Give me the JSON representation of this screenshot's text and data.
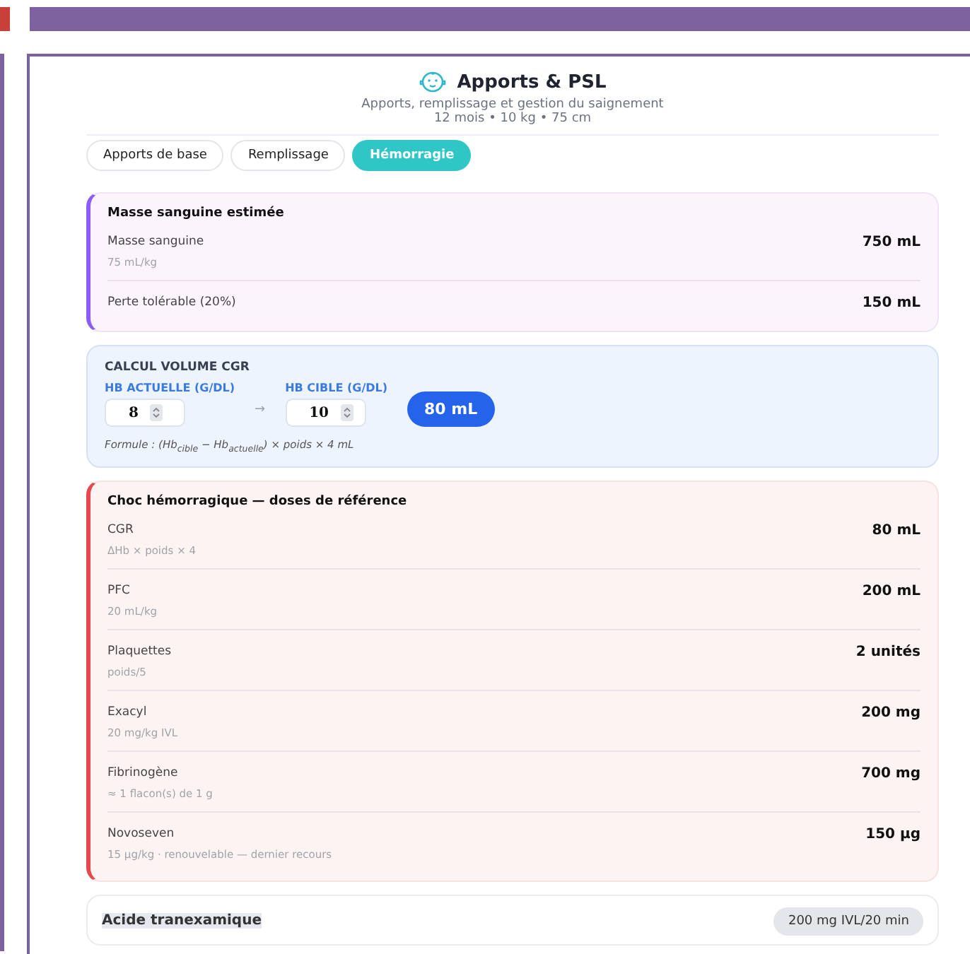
{
  "header": {
    "title": "Apports & PSL",
    "subtitle": "Apports, remplissage et gestion du saignement",
    "meta": "12 mois • 10 kg • 75 cm"
  },
  "tabs": [
    {
      "label": "Apports de base",
      "selected": false
    },
    {
      "label": "Remplissage",
      "selected": false
    },
    {
      "label": "Hémorragie",
      "selected": true
    }
  ],
  "blood_mass": {
    "title": "Masse sanguine estimée",
    "rows": [
      {
        "label": "Masse sanguine",
        "note": "75 mL/kg",
        "value": "750 mL"
      },
      {
        "label": "Perte tolérable (20%)",
        "value": "150 mL"
      }
    ]
  },
  "cgr_calc": {
    "title": "CALCUL VOLUME CGR",
    "current": {
      "label": "HB ACTUELLE (G/DL)",
      "value": "8"
    },
    "arrow": "→",
    "target": {
      "label": "HB CIBLE (G/DL)",
      "value": "10"
    },
    "result": "80 mL",
    "formula": "Formule : (Hb$_{cible}$ − Hb$_{actuelle}$) × poids × 4 mL"
  },
  "shock_doses": {
    "title": "Choc hémorragique — doses de référence",
    "rows": [
      {
        "label": "CGR",
        "note": "ΔHb × poids × 4",
        "value": "80 mL"
      },
      {
        "label": "PFC",
        "note": "20 mL/kg",
        "value": "200 mL"
      },
      {
        "label": "Plaquettes",
        "note": "poids/5",
        "value": "2 unités"
      },
      {
        "label": "Exacyl",
        "note": "20 mg/kg IVL",
        "value": "200 mg"
      },
      {
        "label": "Fibrinogène",
        "note": "≈ 1 flacon(s) de 1 g",
        "value": "700 mg"
      },
      {
        "label": "Novoseven",
        "note": "15 µg/kg · renouvelable — dernier recours",
        "value": "150 µg"
      }
    ]
  },
  "tranexamic": {
    "label": "Acide tranexamique",
    "value": "200 mg IVL/20 min"
  }
}
